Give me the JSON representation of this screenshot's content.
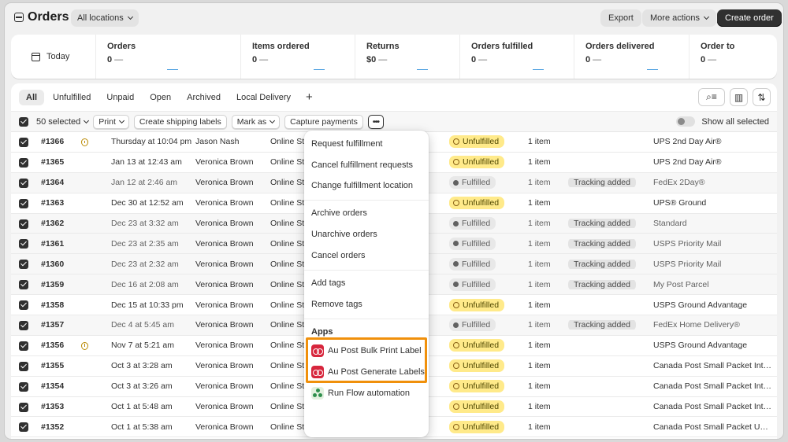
{
  "header": {
    "title": "Orders",
    "location_button": "All locations",
    "export_label": "Export",
    "more_actions_label": "More actions",
    "create_order_label": "Create order"
  },
  "metrics": {
    "date_label": "Today",
    "cards": [
      {
        "label": "Orders",
        "value": "0",
        "trend": "—"
      },
      {
        "label": "Items ordered",
        "value": "0",
        "trend": "—"
      },
      {
        "label": "Returns",
        "value": "$0",
        "trend": "—"
      },
      {
        "label": "Orders fulfilled",
        "value": "0",
        "trend": "—"
      },
      {
        "label": "Orders delivered",
        "value": "0",
        "trend": "—"
      },
      {
        "label": "Order to",
        "value": "0",
        "trend": "—"
      }
    ]
  },
  "tabs": [
    "All",
    "Unfulfilled",
    "Unpaid",
    "Open",
    "Archived",
    "Local Delivery",
    "+"
  ],
  "toolbar": {
    "search_icon": "search-filter-icon",
    "columns_icon": "columns-icon",
    "sort_icon": "sort-icon"
  },
  "bulk": {
    "selected_label": "50 selected",
    "print_label": "Print",
    "shipping_labels_label": "Create shipping labels",
    "mark_as_label": "Mark as",
    "capture_label": "Capture payments",
    "more_label": "•••",
    "show_all_label": "Show all selected"
  },
  "orders": [
    {
      "id": "#1366",
      "flag": true,
      "date": "Thursday at 10:04 pm",
      "customer": "Jason Nash",
      "channel": "Online Store",
      "status": "Unfulfilled",
      "items": "1 item",
      "tracking": "",
      "shipping": "UPS 2nd Day Air®",
      "grey": false
    },
    {
      "id": "#1365",
      "flag": false,
      "date": "Jan 13 at 12:43 am",
      "customer": "Veronica Brown",
      "channel": "Online Store",
      "status": "Unfulfilled",
      "items": "1 item",
      "tracking": "",
      "shipping": "UPS 2nd Day Air®",
      "grey": false
    },
    {
      "id": "#1364",
      "flag": false,
      "date": "Jan 12 at 2:46 am",
      "customer": "Veronica Brown",
      "channel": "Online Store",
      "status": "Fulfilled",
      "items": "1 item",
      "tracking": "Tracking added",
      "shipping": "FedEx 2Day®",
      "grey": true
    },
    {
      "id": "#1363",
      "flag": false,
      "date": "Dec 30 at 12:52 am",
      "customer": "Veronica Brown",
      "channel": "Online Store",
      "status": "Unfulfilled",
      "items": "1 item",
      "tracking": "",
      "shipping": "UPS® Ground",
      "grey": false
    },
    {
      "id": "#1362",
      "flag": false,
      "date": "Dec 23 at 3:32 am",
      "customer": "Veronica Brown",
      "channel": "Online Store",
      "status": "Fulfilled",
      "items": "1 item",
      "tracking": "Tracking added",
      "shipping": "Standard",
      "grey": true
    },
    {
      "id": "#1361",
      "flag": false,
      "date": "Dec 23 at 2:35 am",
      "customer": "Veronica Brown",
      "channel": "Online Store",
      "status": "Fulfilled",
      "items": "1 item",
      "tracking": "Tracking added",
      "shipping": "USPS Priority Mail",
      "grey": true
    },
    {
      "id": "#1360",
      "flag": false,
      "date": "Dec 23 at 2:32 am",
      "customer": "Veronica Brown",
      "channel": "Online Store",
      "status": "Fulfilled",
      "items": "1 item",
      "tracking": "Tracking added",
      "shipping": "USPS Priority Mail",
      "grey": true
    },
    {
      "id": "#1359",
      "flag": false,
      "date": "Dec 16 at 2:08 am",
      "customer": "Veronica Brown",
      "channel": "Online Store",
      "status": "Fulfilled",
      "items": "1 item",
      "tracking": "Tracking added",
      "shipping": "My Post Parcel",
      "grey": true
    },
    {
      "id": "#1358",
      "flag": false,
      "date": "Dec 15 at 10:33 pm",
      "customer": "Veronica Brown",
      "channel": "Online Store",
      "status": "Unfulfilled",
      "items": "1 item",
      "tracking": "",
      "shipping": "USPS Ground Advantage",
      "grey": false
    },
    {
      "id": "#1357",
      "flag": false,
      "date": "Dec 4 at 5:45 am",
      "customer": "Veronica Brown",
      "channel": "Online Store",
      "status": "Fulfilled",
      "items": "1 item",
      "tracking": "Tracking added",
      "shipping": "FedEx Home Delivery®",
      "grey": true
    },
    {
      "id": "#1356",
      "flag": true,
      "date": "Nov 7 at 5:21 am",
      "customer": "Veronica Brown",
      "channel": "Online Store",
      "status": "Unfulfilled",
      "items": "1 item",
      "tracking": "",
      "shipping": "USPS Ground Advantage",
      "grey": false
    },
    {
      "id": "#1355",
      "flag": false,
      "date": "Oct 3 at 3:28 am",
      "customer": "Veronica Brown",
      "channel": "Online Store",
      "status": "Unfulfilled",
      "items": "1 item",
      "tracking": "",
      "shipping": "Canada Post Small Packet Inte...",
      "grey": false
    },
    {
      "id": "#1354",
      "flag": false,
      "date": "Oct 3 at 3:26 am",
      "customer": "Veronica Brown",
      "channel": "Online Store",
      "status": "Unfulfilled",
      "items": "1 item",
      "tracking": "",
      "shipping": "Canada Post Small Packet Inte...",
      "grey": false
    },
    {
      "id": "#1353",
      "flag": false,
      "date": "Oct 1 at 5:48 am",
      "customer": "Veronica Brown",
      "channel": "Online Store",
      "status": "Unfulfilled",
      "items": "1 item",
      "tracking": "",
      "shipping": "Canada Post Small Packet Inte...",
      "grey": false
    },
    {
      "id": "#1352",
      "flag": false,
      "date": "Oct 1 at 5:38 am",
      "customer": "Veronica Brown",
      "channel": "Online Store",
      "status": "Unfulfilled",
      "items": "1 item",
      "tracking": "",
      "shipping": "Canada Post Small Packet USA ...",
      "grey": false
    }
  ],
  "menu": {
    "request_fulfillment": "Request fulfillment",
    "cancel_fulfillment_requests": "Cancel fulfillment requests",
    "change_fulfillment_location": "Change fulfillment location",
    "archive_orders": "Archive orders",
    "unarchive_orders": "Unarchive orders",
    "cancel_orders": "Cancel orders",
    "add_tags": "Add tags",
    "remove_tags": "Remove tags",
    "apps_heading": "Apps",
    "au_post_bulk_print": "Au Post Bulk Print Label",
    "au_post_generate": "Au Post Generate Labels",
    "run_flow": "Run Flow automation"
  },
  "colors": {
    "highlight": "#f0900b",
    "unfulfilled_badge": "#ffea8a",
    "fulfilled_badge": "#e8e8e8",
    "app_icon": "#d7263d"
  }
}
